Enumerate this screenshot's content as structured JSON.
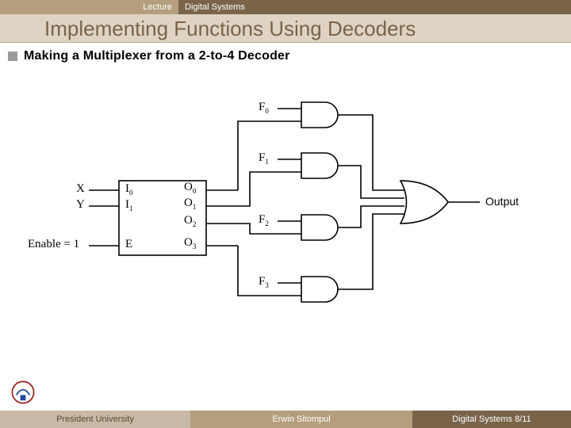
{
  "header": {
    "lecture_label": "Lecture",
    "course": "Digital Systems",
    "title": "Implementing Functions Using Decoders"
  },
  "bullet": "Making a Multiplexer from a 2-to-4 Decoder",
  "diagram": {
    "inputs": {
      "x": "X",
      "y": "Y",
      "enable": "Enable = 1"
    },
    "decoder_in": {
      "i0": "I",
      "i0_sub": "0",
      "i1": "I",
      "i1_sub": "1",
      "e": "E"
    },
    "decoder_out": {
      "o0": "O",
      "o0_sub": "0",
      "o1": "O",
      "o1_sub": "1",
      "o2": "O",
      "o2_sub": "2",
      "o3": "O",
      "o3_sub": "3"
    },
    "data_inputs": {
      "f0": "F",
      "f0_sub": "0",
      "f1": "F",
      "f1_sub": "1",
      "f2": "F",
      "f2_sub": "2",
      "f3": "F",
      "f3_sub": "3"
    },
    "output_label": "Output"
  },
  "footer": {
    "left": "President University",
    "middle": "Erwin Sitompul",
    "right": "Digital Systems 8/11"
  },
  "chart_data": {
    "type": "diagram",
    "description": "2-to-4 decoder block with inputs I0 I1 E and outputs O0..O3. Each output Oi feeds one input of a 2-input AND gate whose other input is data line Fi. The four AND outputs feed a 4-input OR gate producing Output. Enable is tied to 1.",
    "decoder": {
      "inputs": [
        "I0",
        "I1",
        "E"
      ],
      "outputs": [
        "O0",
        "O1",
        "O2",
        "O3"
      ]
    },
    "and_gates": [
      {
        "inputs": [
          "F0",
          "O0"
        ],
        "output": "g0"
      },
      {
        "inputs": [
          "F1",
          "O1"
        ],
        "output": "g1"
      },
      {
        "inputs": [
          "F2",
          "O2"
        ],
        "output": "g2"
      },
      {
        "inputs": [
          "F3",
          "O3"
        ],
        "output": "g3"
      }
    ],
    "or_gate": {
      "inputs": [
        "g0",
        "g1",
        "g2",
        "g3"
      ],
      "output": "Output"
    },
    "signal_bindings": {
      "I0": "X",
      "I1": "Y",
      "E": 1
    }
  }
}
